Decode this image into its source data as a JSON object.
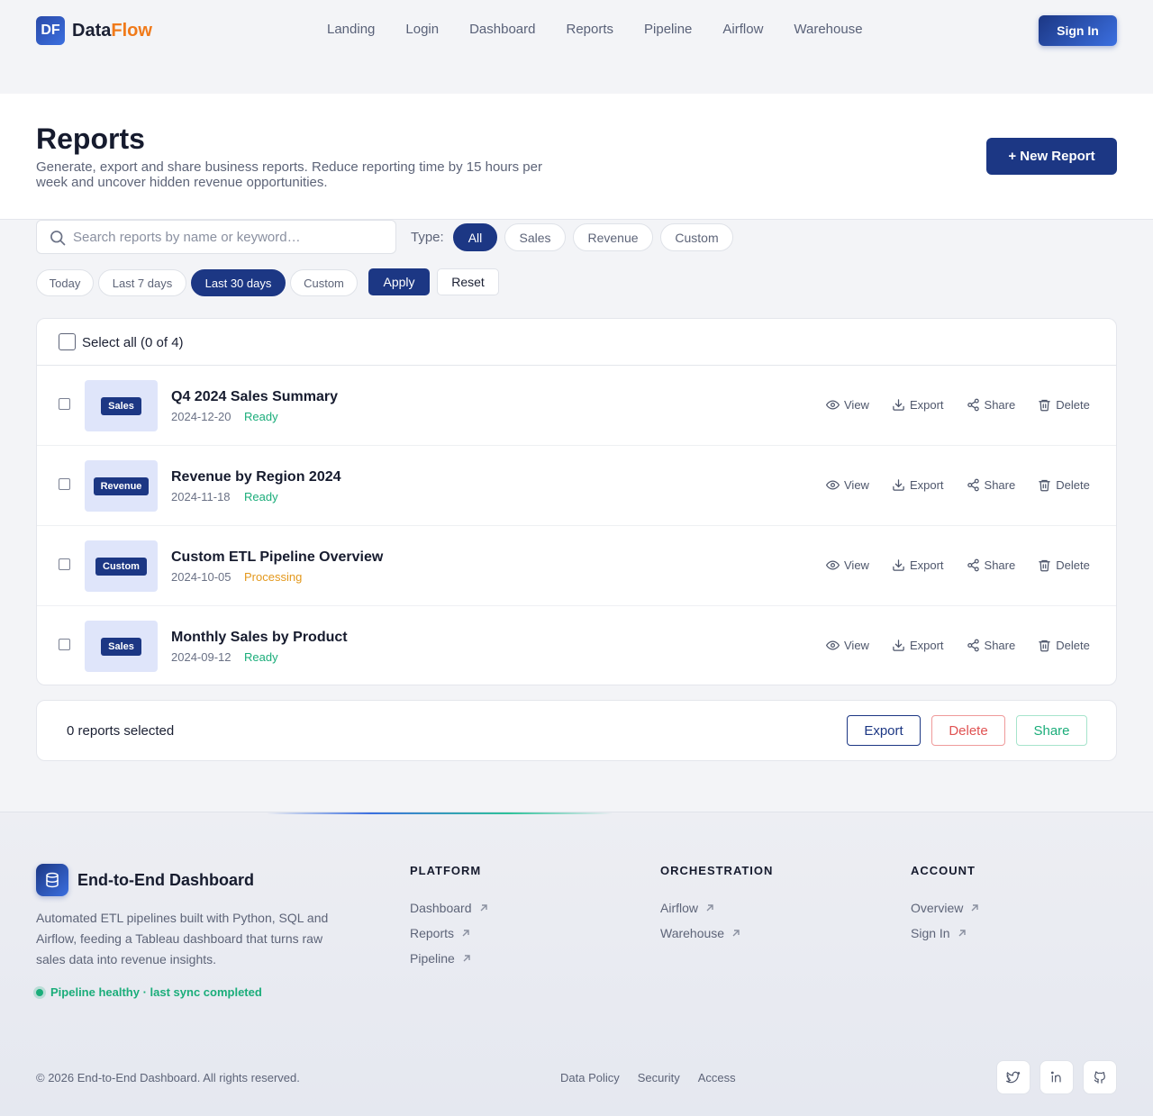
{
  "nav": {
    "logo_mark": "DF",
    "brand_main": "Data",
    "brand_accent": "Flow",
    "links": [
      "Landing",
      "Login",
      "Dashboard",
      "Reports",
      "Pipeline",
      "Airflow",
      "Warehouse"
    ],
    "signin": "Sign In"
  },
  "header": {
    "title": "Reports",
    "subtitle": "Generate, export and share business reports. Reduce reporting time by 15  hours per week and uncover hidden revenue opportunities.",
    "new_button": "+ New Report"
  },
  "filters": {
    "search_placeholder": "Search reports by name or keyword…",
    "search_value": "",
    "type_label": "Type:",
    "types": [
      "All",
      "Sales",
      "Revenue",
      "Custom"
    ],
    "active_type": "All",
    "ranges": [
      "Today",
      "Last 7 days",
      "Last 30 days",
      "Custom"
    ],
    "active_range": "Last 30 days",
    "apply": "Apply",
    "reset": "Reset"
  },
  "list": {
    "select_all": "Select all (0 of 4)",
    "action_labels": {
      "view": "View",
      "export": "Export",
      "share": "Share",
      "delete": "Delete"
    },
    "reports": [
      {
        "badge": "Sales",
        "title": "Q4 2024 Sales Summary",
        "date": "2024-12-20",
        "status": "Ready"
      },
      {
        "badge": "Revenue",
        "title": "Revenue by Region 2024",
        "date": "2024-11-18",
        "status": "Ready"
      },
      {
        "badge": "Custom",
        "title": "Custom ETL Pipeline Overview",
        "date": "2024-10-05",
        "status": "Processing"
      },
      {
        "badge": "Sales",
        "title": "Monthly Sales by Product",
        "date": "2024-09-12",
        "status": "Ready"
      }
    ]
  },
  "bulk": {
    "count": "0 reports selected",
    "export": "Export",
    "delete": "Delete",
    "share": "Share"
  },
  "footer": {
    "title": "End-to-End Dashboard",
    "description": "Automated ETL pipelines built with Python, SQL and Airflow, feeding a Tableau dashboard that turns raw sales data into revenue insights.",
    "health": "Pipeline healthy · last sync completed",
    "columns": [
      {
        "heading": "PLATFORM",
        "links": [
          "Dashboard",
          "Reports",
          "Pipeline"
        ]
      },
      {
        "heading": "ORCHESTRATION",
        "links": [
          "Airflow",
          "Warehouse"
        ]
      },
      {
        "heading": "ACCOUNT",
        "links": [
          "Overview",
          "Sign In"
        ]
      }
    ],
    "copyright": "© 2026 End-to-End Dashboard. All rights reserved.",
    "legal": [
      "Data Policy",
      "Security",
      "Access"
    ],
    "social": [
      "twitter-icon",
      "linkedin-icon",
      "github-icon"
    ]
  },
  "colors": {
    "primary": "#1c3784",
    "brand_accent": "#f07a1a",
    "ready": "#1bad7a",
    "processing": "#e3981c",
    "danger": "#e05252"
  }
}
